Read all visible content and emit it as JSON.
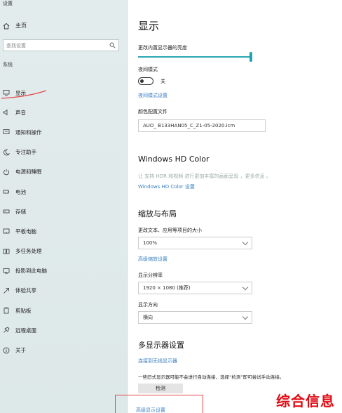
{
  "sidebar": {
    "app_title": "设置",
    "home_label": "主页",
    "search_placeholder": "查找设置",
    "section_label": "系统",
    "items": [
      {
        "label": "显示",
        "icon": "monitor-icon"
      },
      {
        "label": "声音",
        "icon": "speaker-icon"
      },
      {
        "label": "通知和操作",
        "icon": "notification-icon"
      },
      {
        "label": "专注助手",
        "icon": "moon-icon"
      },
      {
        "label": "电源和睡眠",
        "icon": "power-icon"
      },
      {
        "label": "电池",
        "icon": "battery-icon"
      },
      {
        "label": "存储",
        "icon": "storage-icon"
      },
      {
        "label": "平板电脑",
        "icon": "tablet-icon"
      },
      {
        "label": "多任务处理",
        "icon": "multitask-icon"
      },
      {
        "label": "投影到此电脑",
        "icon": "projector-icon"
      },
      {
        "label": "体验共享",
        "icon": "share-icon"
      },
      {
        "label": "剪贴板",
        "icon": "clipboard-icon"
      },
      {
        "label": "远程桌面",
        "icon": "remote-icon"
      },
      {
        "label": "关于",
        "icon": "info-icon"
      }
    ]
  },
  "main": {
    "title": "显示",
    "brightness_label": "更改内置显示器的亮度",
    "brightness_value": 1.0,
    "night_mode_label": "夜间模式",
    "night_mode_state": "关",
    "night_mode_link": "夜间模式设置",
    "color_profile_label": "颜色配置文件",
    "color_profile_value": "AUO_      B133HAN05_C_Z1-05-2020.icm",
    "hd_color_title": "Windows HD Color",
    "hd_color_desc": "让 支持 HDR 和视频          进行更加丰富的画面呈现 ，更多信息 。",
    "hd_color_link": "Windows HD Color 设置",
    "scale_title": "缩放与布局",
    "scale_label": "更改文本、应用等项目的大小",
    "scale_value": "100%",
    "scale_link": "高级缩放设置",
    "resolution_label": "显示分辨率",
    "resolution_value": "1920 × 1080 (推荐)",
    "orientation_label": "显示方向",
    "orientation_value": "横向",
    "multi_title": "多显示器设置",
    "multi_link": "连接到无线显示器",
    "multi_desc": "一些旧式显示器可能不会进行自动连接，选择“检测”即可尝试手动连接。",
    "detect_button": "检测",
    "advanced_link": "高级显示设置"
  },
  "watermark": "综合信息",
  "colors": {
    "accent": "#1ea3b2",
    "link": "#3b7fbf",
    "annotation": "#e2484d",
    "watermark": "#e10b14"
  }
}
